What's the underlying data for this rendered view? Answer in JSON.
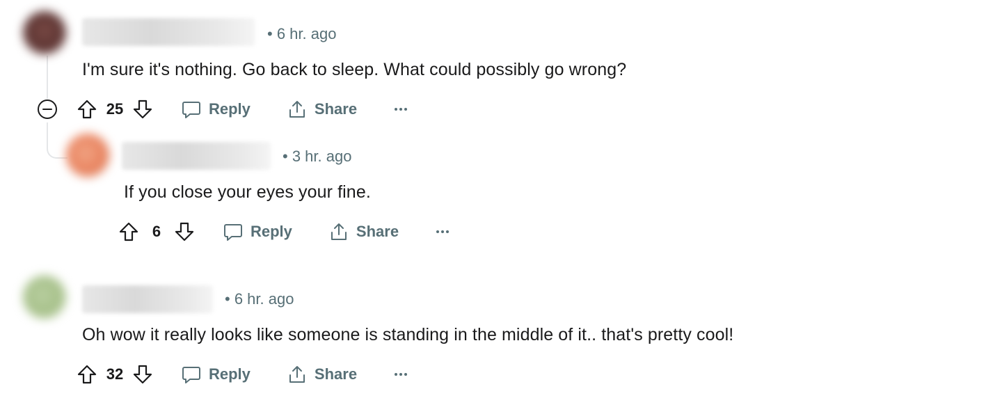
{
  "comments": [
    {
      "time": "6 hr. ago",
      "body": "I'm sure it's nothing. Go back to sleep. What could possibly go wrong?",
      "score": "25",
      "reply_label": "Reply",
      "share_label": "Share",
      "icons": [
        "upvote-icon",
        "downvote-icon",
        "reply-icon",
        "share-icon",
        "more-icon",
        "collapse-icon"
      ]
    },
    {
      "time": "3 hr. ago",
      "body": "If you close your eyes your fine.",
      "score": "6",
      "reply_label": "Reply",
      "share_label": "Share",
      "icons": [
        "upvote-icon",
        "downvote-icon",
        "reply-icon",
        "share-icon",
        "more-icon"
      ]
    },
    {
      "time": "6 hr. ago",
      "body": "Oh wow it really looks like someone is standing in the middle of it.. that's pretty cool!",
      "score": "32",
      "reply_label": "Reply",
      "share_label": "Share",
      "icons": [
        "upvote-icon",
        "downvote-icon",
        "reply-icon",
        "share-icon",
        "more-icon"
      ]
    }
  ],
  "colors": {
    "text": "#1a1a1b",
    "muted": "#576f76",
    "thread_line": "#e4e6e8"
  }
}
